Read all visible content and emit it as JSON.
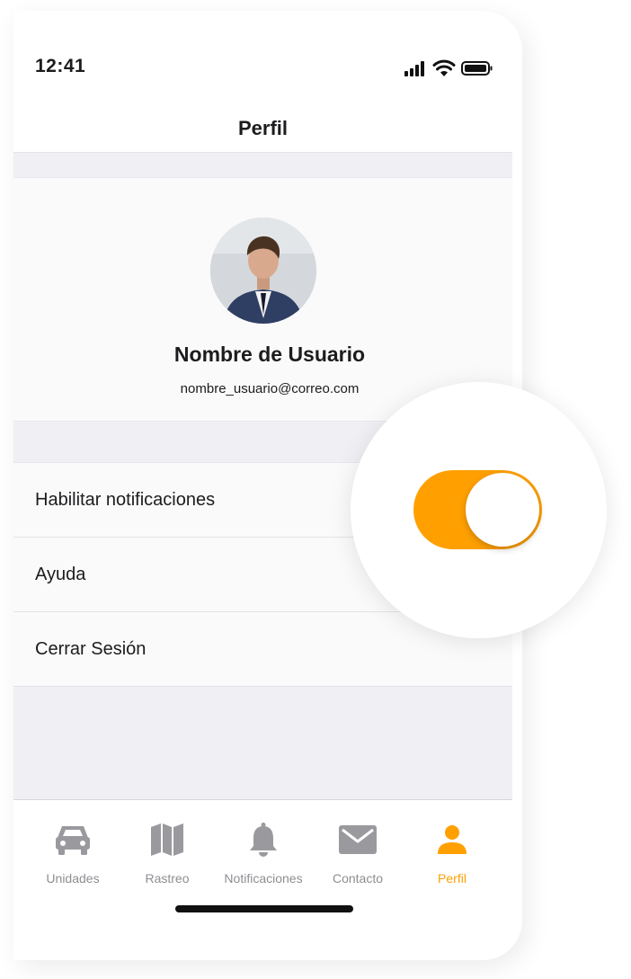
{
  "status_bar": {
    "time": "12:41"
  },
  "nav": {
    "title": "Perfil"
  },
  "profile": {
    "name": "Nombre de Usuario",
    "email": "nombre_usuario@correo.com"
  },
  "settings": {
    "items": [
      {
        "label": "Habilitar notificaciones"
      },
      {
        "label": "Ayuda"
      },
      {
        "label": "Cerrar Sesión"
      }
    ],
    "notifications_enabled": true
  },
  "tabs": [
    {
      "label": "Unidades",
      "icon": "car-icon",
      "active": false
    },
    {
      "label": "Rastreo",
      "icon": "map-icon",
      "active": false
    },
    {
      "label": "Notificaciones",
      "icon": "bell-icon",
      "active": false
    },
    {
      "label": "Contacto",
      "icon": "mail-icon",
      "active": false
    },
    {
      "label": "Perfil",
      "icon": "person-icon",
      "active": true
    }
  ],
  "colors": {
    "accent": "#ffa000",
    "inactive": "#8e8e93",
    "background": "#f0f0f4"
  }
}
